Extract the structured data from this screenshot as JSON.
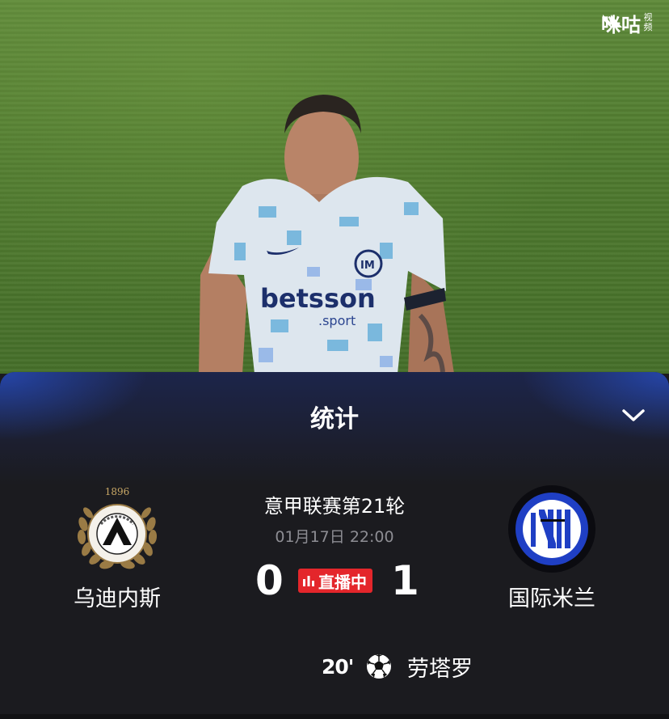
{
  "watermark": {
    "brand": "咪咕",
    "sub": "视频"
  },
  "panel": {
    "title": "统计",
    "collapse_icon": "chevron-down-icon"
  },
  "match": {
    "league_round": "意甲联赛第21轮",
    "datetime": "01月17日 22:00",
    "status": "直播中",
    "home": {
      "name": "乌迪内斯",
      "score": "0",
      "crest_year": "1896",
      "crest_text": "UDINESE CALCIO"
    },
    "away": {
      "name": "国际米兰",
      "score": "1"
    }
  },
  "events": [
    {
      "minute": "20'",
      "type": "goal",
      "icon": "soccer-ball-icon",
      "player": "劳塔罗"
    }
  ],
  "colors": {
    "live_red": "#e4262b",
    "panel_bg": "#1b1b1f",
    "inter_blue": "#1f3fc4",
    "udinese_gold": "#9a7b45",
    "secondary_text": "#8d8d93"
  }
}
